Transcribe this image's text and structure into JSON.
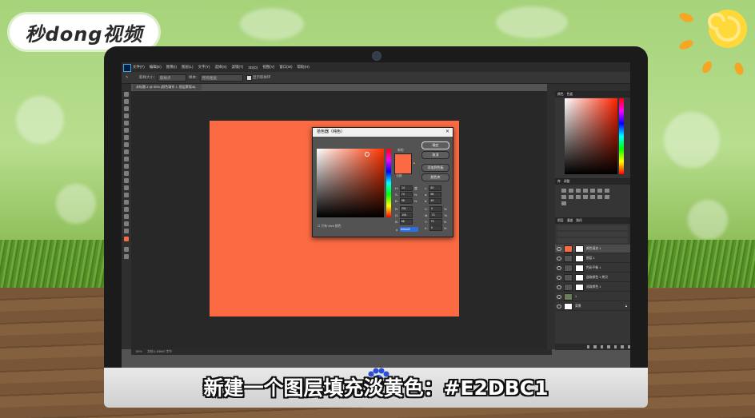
{
  "brand": {
    "logo_text": "秒dong视频"
  },
  "menubar": {
    "items": [
      "文件(F)",
      "编辑(E)",
      "图像(I)",
      "图层(L)",
      "文字(Y)",
      "选择(S)",
      "滤镜(T)",
      "3D(D)",
      "视图(V)",
      "窗口(W)",
      "帮助(H)"
    ]
  },
  "options": {
    "sample_size_label": "取样大小：",
    "sample_size_value": "取样点",
    "sample_label": "样本：",
    "sample_value": "所有图层",
    "show_ring": "显示取样环"
  },
  "document": {
    "tab_label": "未标题-1 @ 50% (颜色填充 1, 图层蒙版/8)"
  },
  "status": {
    "zoom": "50%",
    "doc_size": "文档:1.83M/0 字节"
  },
  "color_picker": {
    "title": "拾色器（纯色）",
    "ok": "确定",
    "cancel": "取消",
    "add_to_swatches": "添加到色板",
    "color_libraries": "颜色库",
    "new_label": "新的",
    "current_label": "当前",
    "web_only": "只有 Web 颜色",
    "hex_label": "#",
    "hex_value": "fb6a42",
    "fields": {
      "H": "14",
      "S": "74",
      "B": "98",
      "R": "251",
      "G": "106",
      "Bv": "66",
      "L": "62",
      "a": "56",
      "b2": "49",
      "C": "0",
      "M": "73",
      "Y": "73",
      "K": "0"
    },
    "units": {
      "deg": "度",
      "pct": "%"
    }
  },
  "panels": {
    "color_tabs": [
      "颜色",
      "色板"
    ],
    "adjust_tabs": [
      "库",
      "调整"
    ],
    "layers_tabs": [
      "图层",
      "通道",
      "路径"
    ],
    "layers": [
      {
        "name": "颜色填充 1",
        "selected": true,
        "thumb": "orange"
      },
      {
        "name": "图层 1",
        "selected": false,
        "thumb": "white"
      },
      {
        "name": "色彩平衡 1",
        "selected": false,
        "thumb": "white"
      },
      {
        "name": "选取颜色 1 拷贝",
        "selected": false,
        "thumb": "white"
      },
      {
        "name": "选取颜色 1",
        "selected": false,
        "thumb": "white"
      },
      {
        "name": "1",
        "selected": false,
        "thumb": "dark"
      },
      {
        "name": "背景",
        "selected": false,
        "thumb": "white"
      }
    ]
  },
  "subtitle": {
    "text": "新建一个图层填充淡黄色：#E2DBC1"
  },
  "colors": {
    "fill": "#fb6a42",
    "canvas_bg": "#282828",
    "ps_panel": "#353535"
  }
}
